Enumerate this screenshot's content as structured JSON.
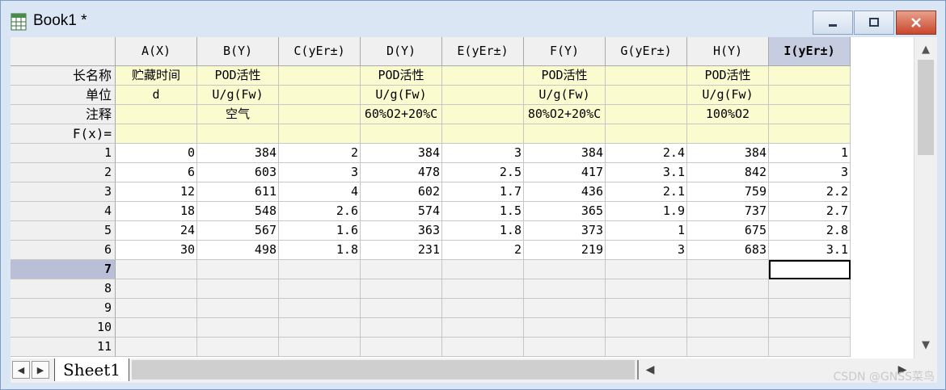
{
  "window": {
    "title": "Book1 *"
  },
  "columns": [
    "A(X)",
    "B(Y)",
    "C(yEr±)",
    "D(Y)",
    "E(yEr±)",
    "F(Y)",
    "G(yEr±)",
    "H(Y)",
    "I(yEr±)"
  ],
  "meta_rows": [
    {
      "label": "长名称",
      "values": [
        "贮藏时间",
        "POD活性",
        "",
        "POD活性",
        "",
        "POD活性",
        "",
        "POD活性",
        ""
      ]
    },
    {
      "label": "单位",
      "values": [
        "d",
        "U/g(Fw)",
        "",
        "U/g(Fw)",
        "",
        "U/g(Fw)",
        "",
        "U/g(Fw)",
        ""
      ]
    },
    {
      "label": "注释",
      "values": [
        "",
        "空气",
        "",
        "60%O2+20%C",
        "",
        "80%O2+20%C",
        "",
        "100%O2",
        ""
      ]
    },
    {
      "label": "F(x)=",
      "values": [
        "",
        "",
        "",
        "",
        "",
        "",
        "",
        "",
        ""
      ]
    }
  ],
  "data_rows": [
    {
      "label": "1",
      "values": [
        "0",
        "384",
        "2",
        "384",
        "3",
        "384",
        "2.4",
        "384",
        "1"
      ]
    },
    {
      "label": "2",
      "values": [
        "6",
        "603",
        "3",
        "478",
        "2.5",
        "417",
        "3.1",
        "842",
        "3"
      ]
    },
    {
      "label": "3",
      "values": [
        "12",
        "611",
        "4",
        "602",
        "1.7",
        "436",
        "2.1",
        "759",
        "2.2"
      ]
    },
    {
      "label": "4",
      "values": [
        "18",
        "548",
        "2.6",
        "574",
        "1.5",
        "365",
        "1.9",
        "737",
        "2.7"
      ]
    },
    {
      "label": "5",
      "values": [
        "24",
        "567",
        "1.6",
        "363",
        "1.8",
        "373",
        "1",
        "675",
        "2.8"
      ]
    },
    {
      "label": "6",
      "values": [
        "30",
        "498",
        "1.8",
        "231",
        "2",
        "219",
        "3",
        "683",
        "3.1"
      ]
    },
    {
      "label": "7",
      "values": [
        "",
        "",
        "",
        "",
        "",
        "",
        "",
        "",
        ""
      ]
    },
    {
      "label": "8",
      "values": [
        "",
        "",
        "",
        "",
        "",
        "",
        "",
        "",
        ""
      ]
    },
    {
      "label": "9",
      "values": [
        "",
        "",
        "",
        "",
        "",
        "",
        "",
        "",
        ""
      ]
    },
    {
      "label": "10",
      "values": [
        "",
        "",
        "",
        "",
        "",
        "",
        "",
        "",
        ""
      ]
    },
    {
      "label": "11",
      "values": [
        "",
        "",
        "",
        "",
        "",
        "",
        "",
        "",
        ""
      ]
    }
  ],
  "selected_column": "I(yEr±)",
  "active_row": "7",
  "sheet_tab": "Sheet1",
  "watermark": "CSDN @GNSS菜鸟",
  "colors": {
    "meta_bg": "#fbfbd0",
    "selected_header": "#c7cde0",
    "close_button": "#c9462c"
  }
}
